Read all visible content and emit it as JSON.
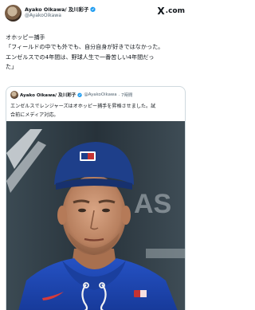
{
  "post": {
    "author_name": "Ayako Oikawa/ 及川彩子",
    "author_handle": "@AyakoOikawa",
    "brand": {
      "x": "X",
      "com": ".com"
    },
    "lines": [
      "オホッピー捕手",
      "「フィールドの中でも外でも、自分自身が好きではなかった。",
      "エンゼルスでの4年間は、野球人生で一番苦しい4年間だっ",
      "た」"
    ]
  },
  "quoted": {
    "author_name": "Ayako Oikawa/ 及川彩子",
    "author_handle": "@AyakoOikawa",
    "time": "· 7時間",
    "lines": [
      "エンゼルスでレンジャーズはオホッピー捕手を昇格させました。試",
      "合前にメディア対応。"
    ]
  },
  "colors": {
    "verified": "#1d9bf0",
    "cap": "#1e3f8a",
    "hoodie": "#1f47b8"
  },
  "icons": {
    "verified": "verified-badge-icon",
    "brand": "x-logo-icon"
  }
}
